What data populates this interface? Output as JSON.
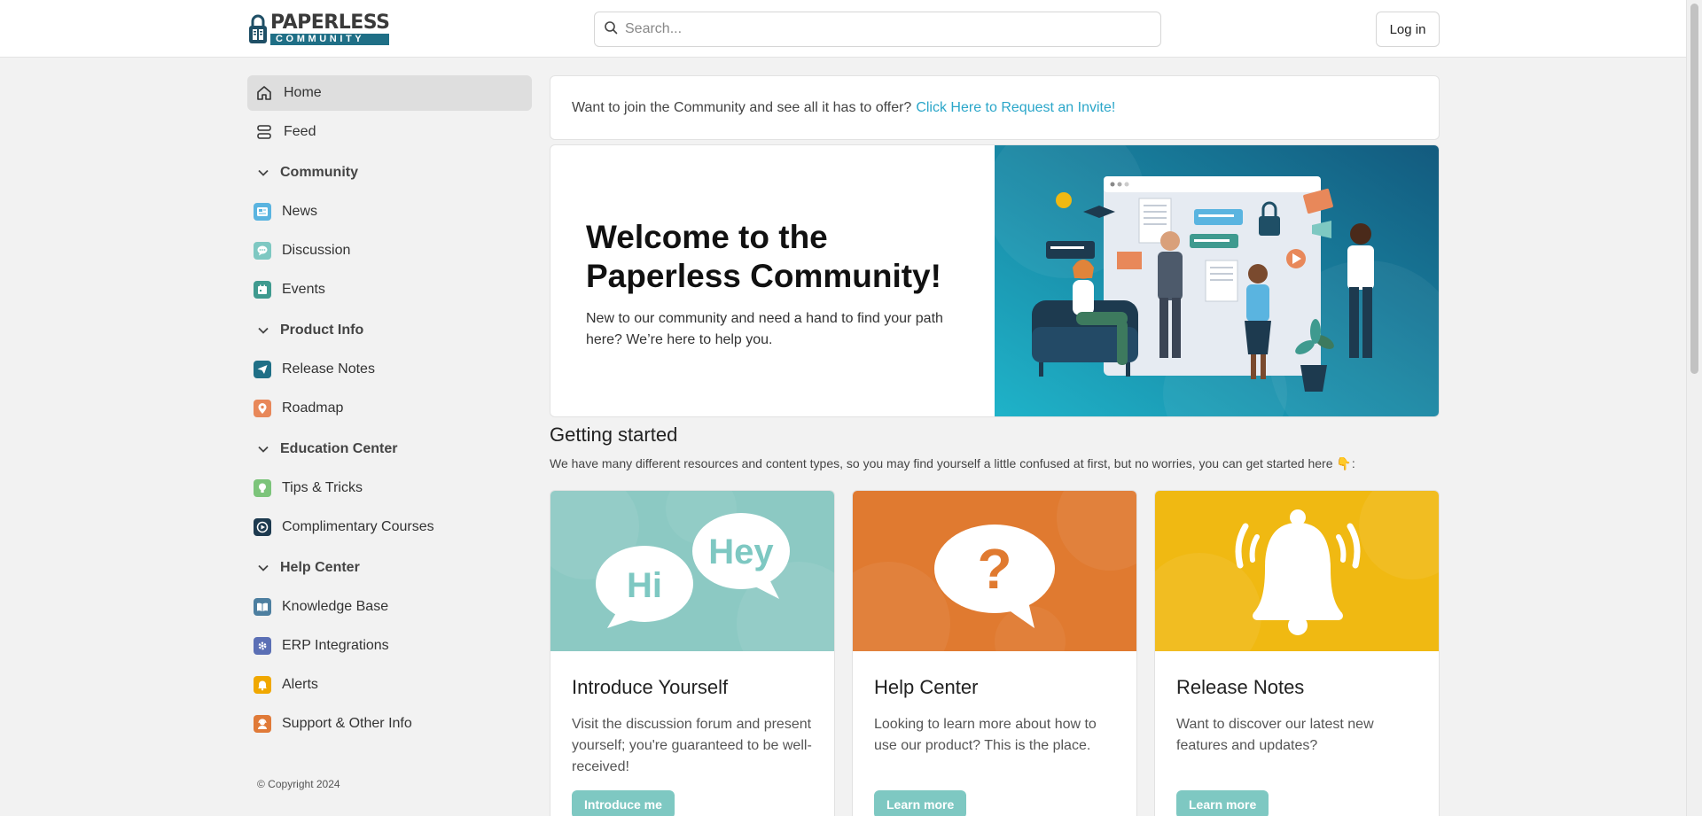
{
  "brand": {
    "name_top": "PAPERLESS",
    "name_bottom": "COMMUNITY"
  },
  "header": {
    "search_placeholder": "Search...",
    "login_label": "Log in"
  },
  "sidebar": {
    "top_items": [
      {
        "label": "Home",
        "icon": "home-icon"
      },
      {
        "label": "Feed",
        "icon": "feed-icon"
      }
    ],
    "sections": [
      {
        "title": "Community",
        "items": [
          {
            "label": "News",
            "icon": "news-icon",
            "color": "#5ab4e0"
          },
          {
            "label": "Discussion",
            "icon": "discussion-icon",
            "color": "#7ec8c2"
          },
          {
            "label": "Events",
            "icon": "events-icon",
            "color": "#3f9a8f"
          }
        ]
      },
      {
        "title": "Product Info",
        "items": [
          {
            "label": "Release Notes",
            "icon": "paper-plane-icon",
            "color": "#1f6f86"
          },
          {
            "label": "Roadmap",
            "icon": "map-pin-icon",
            "color": "#e8885a"
          }
        ]
      },
      {
        "title": "Education Center",
        "items": [
          {
            "label": "Tips & Tricks",
            "icon": "lightbulb-icon",
            "color": "#7cc47a"
          },
          {
            "label": "Complimentary Courses",
            "icon": "play-icon",
            "color": "#1d3a4f"
          }
        ]
      },
      {
        "title": "Help Center",
        "items": [
          {
            "label": "Knowledge Base",
            "icon": "book-icon",
            "color": "#4d7fa0"
          },
          {
            "label": "ERP Integrations",
            "icon": "gear-icon",
            "color": "#5b6fb5"
          },
          {
            "label": "Alerts",
            "icon": "bell-icon",
            "color": "#f0a800"
          },
          {
            "label": "Support & Other Info",
            "icon": "support-icon",
            "color": "#e07a38"
          }
        ]
      }
    ],
    "copyright": "© Copyright 2024"
  },
  "invite": {
    "text": "Want to join the Community and see all it has to offer?",
    "link": "Click Here to Request an Invite!"
  },
  "hero": {
    "title_line1": "Welcome to the",
    "title_line2": "Paperless Community!",
    "subtitle": "New to our community and need a hand to find your path here? We’re here to help you."
  },
  "getting_started": {
    "title": "Getting started",
    "description": "We have many different resources and content types, so you may find yourself a little confused at first, but no worries, you can get started here 👇:"
  },
  "cards": [
    {
      "title": "Introduce Yourself",
      "description": "Visit the discussion forum and present yourself; you're guaranteed to be well-received!",
      "button": "Introduce me",
      "bubble_hi": "Hi",
      "bubble_hey": "Hey",
      "color": "#8cc9c3"
    },
    {
      "title": "Help Center",
      "description": "Looking to learn more about how to use our product? This is the place.",
      "button": "Learn more",
      "bubble_q": "?",
      "color": "#e07a30"
    },
    {
      "title": "Release Notes",
      "description": "Want to discover our latest new features and updates?",
      "button": "Learn more",
      "color": "#f0b912"
    }
  ]
}
